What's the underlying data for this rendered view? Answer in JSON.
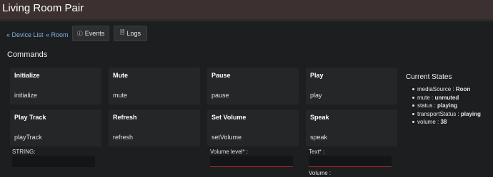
{
  "title": "Living Room Pair",
  "nav": {
    "device_list": "« Device List",
    "room": "« Room",
    "events": "Events",
    "logs": "Logs",
    "events_icon": "info-circle-icon",
    "logs_icon": "document-icon"
  },
  "commands": {
    "heading": "Commands",
    "cards": [
      {
        "title": "Initialize",
        "command": "initialize"
      },
      {
        "title": "Mute",
        "command": "mute"
      },
      {
        "title": "Pause",
        "command": "pause"
      },
      {
        "title": "Play",
        "command": "play"
      },
      {
        "title": "Play Track",
        "command": "playTrack"
      },
      {
        "title": "Refresh",
        "command": "refresh"
      },
      {
        "title": "Set Volume",
        "command": "setVolume"
      },
      {
        "title": "Speak",
        "command": "speak"
      }
    ],
    "args": {
      "play_track_label": "STRING:",
      "set_volume_label": "Volume level* :",
      "speak_text_label": "Text* :",
      "speak_volume_label": "Volume :"
    }
  },
  "states": {
    "heading": "Current States",
    "items": [
      {
        "key": "mediaSource",
        "value": "Roon"
      },
      {
        "key": "mute",
        "value": "unmuted"
      },
      {
        "key": "status",
        "value": "playing"
      },
      {
        "key": "transportStatus",
        "value": "playing"
      },
      {
        "key": "volume",
        "value": "38"
      }
    ]
  },
  "colors": {
    "titlebar": "#3c3130",
    "background": "#1d1e20",
    "link": "#7fb2e6",
    "required_underline": "#a12b2b"
  }
}
